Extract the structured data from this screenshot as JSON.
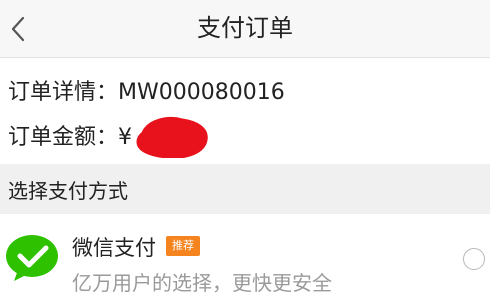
{
  "nav": {
    "back_icon": "chevron-left-icon",
    "title": "支付订单"
  },
  "order": {
    "detail_label": "订单详情：",
    "detail_value": "MW000080016",
    "amount_label": "订单金额：",
    "amount_value": "¥"
  },
  "section": {
    "title": "选择支付方式"
  },
  "payment_methods": [
    {
      "icon": "wechat-pay-icon",
      "name": "微信支付",
      "badge": "推荐",
      "description": "亿万用户的选择，更快更安全",
      "selected": false
    }
  ],
  "colors": {
    "nav_bg": "#f7f7f7",
    "section_bg": "#f0f0f0",
    "badge": "#f5841f",
    "wechat_green": "#2dc100",
    "redaction": "#e8121c"
  }
}
